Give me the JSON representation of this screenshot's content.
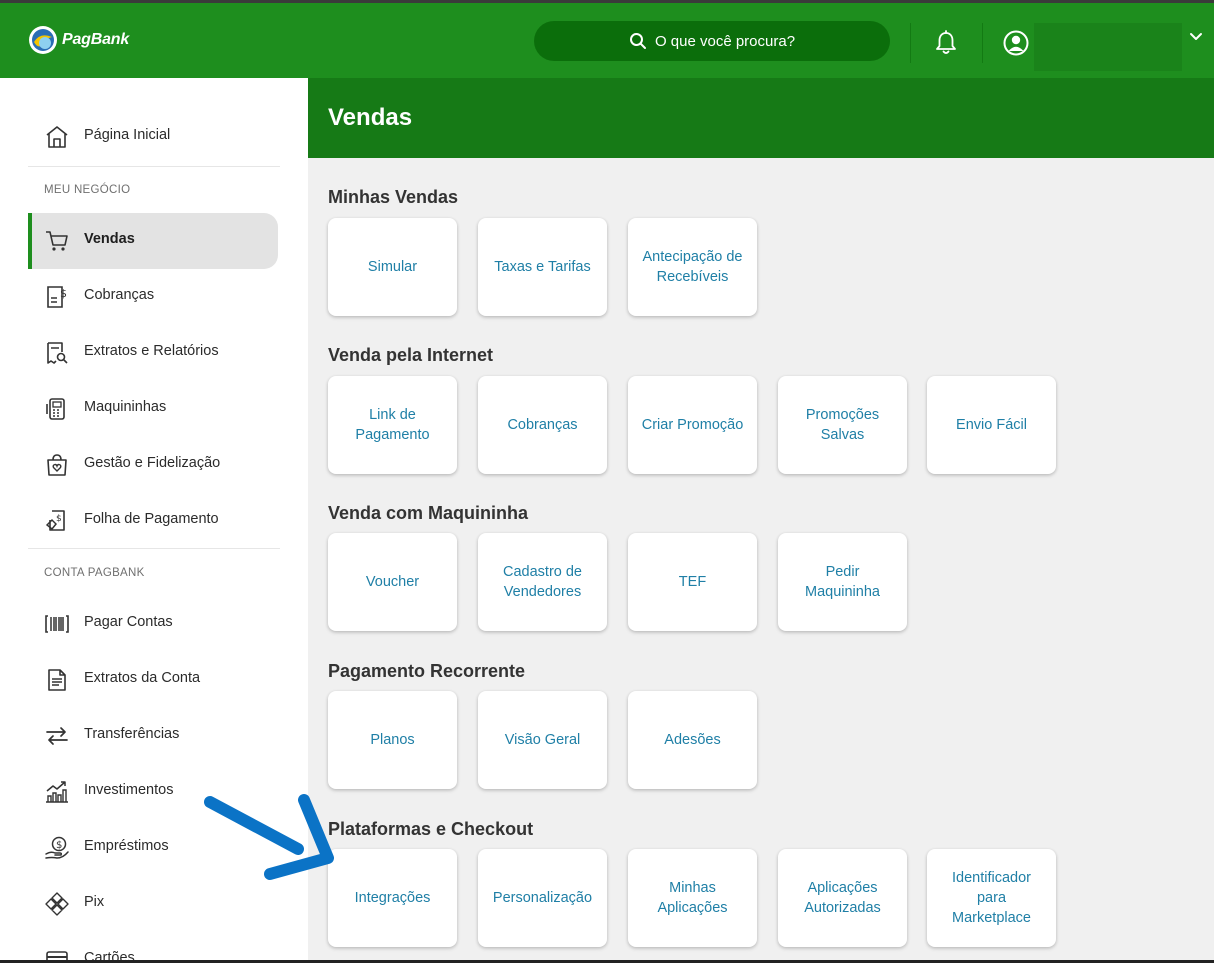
{
  "brand": {
    "name": "PagBank"
  },
  "header": {
    "search_placeholder": "O que você procura?",
    "colors": {
      "brand_green": "#1e8e1e",
      "search_bg": "#0b6e0b",
      "hero_green": "#167a16",
      "link_blue": "#1f7fa6",
      "annotation_arrow": "#0b73c6"
    }
  },
  "sidebar": {
    "home": "Página Inicial",
    "section_business": "MEU NEGÓCIO",
    "business_items": [
      {
        "label": "Vendas",
        "icon": "cart-icon",
        "active": true
      },
      {
        "label": "Cobranças",
        "icon": "invoice-dollar-icon"
      },
      {
        "label": "Extratos e Relatórios",
        "icon": "receipt-search-icon"
      },
      {
        "label": "Maquininhas",
        "icon": "card-machine-icon"
      },
      {
        "label": "Gestão e Fidelização",
        "icon": "shopping-bag-heart-icon"
      },
      {
        "label": "Folha de Pagamento",
        "icon": "payroll-icon"
      }
    ],
    "section_account": "CONTA PAGBANK",
    "account_items": [
      {
        "label": "Pagar Contas",
        "icon": "barcode-icon"
      },
      {
        "label": "Extratos da Conta",
        "icon": "document-icon"
      },
      {
        "label": "Transferências",
        "icon": "transfer-arrows-icon"
      },
      {
        "label": "Investimentos",
        "icon": "chart-growth-icon"
      },
      {
        "label": "Empréstimos",
        "icon": "hand-coin-icon"
      },
      {
        "label": "Pix",
        "icon": "pix-icon"
      },
      {
        "label": "Cartões",
        "icon": "credit-card-icon"
      }
    ]
  },
  "main": {
    "title": "Vendas",
    "sections": [
      {
        "title": "Minhas Vendas",
        "cards": [
          "Simular",
          "Taxas e Tarifas",
          "Antecipação de Recebíveis"
        ]
      },
      {
        "title": "Venda pela Internet",
        "cards": [
          "Link de Pagamento",
          "Cobranças",
          "Criar Promoção",
          "Promoções Salvas",
          "Envio Fácil"
        ]
      },
      {
        "title": "Venda com Maquininha",
        "cards": [
          "Voucher",
          "Cadastro de Vendedores",
          "TEF",
          "Pedir Maquininha"
        ]
      },
      {
        "title": "Pagamento Recorrente",
        "cards": [
          "Planos",
          "Visão Geral",
          "Adesões"
        ]
      },
      {
        "title": "Plataformas e Checkout",
        "cards": [
          "Integrações",
          "Personalização",
          "Minhas Aplicações",
          "Aplicações Autorizadas",
          "Identificador para Marketplace"
        ]
      }
    ]
  }
}
